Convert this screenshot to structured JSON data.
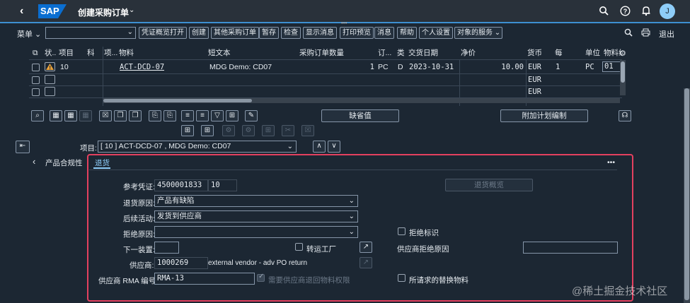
{
  "shell": {
    "logo": "SAP",
    "title": "创建采购订单",
    "avatar_initial": "J",
    "icons": [
      "search-icon",
      "help-icon",
      "bell-icon"
    ]
  },
  "toolbar": {
    "menu_label": "菜单",
    "command_placeholder": "",
    "buttons": [
      "凭证概览打开",
      "创建",
      "其他采购订单",
      "暂存",
      "检查",
      "显示消息",
      "打印预览",
      "消息",
      "帮助",
      "个人设置",
      "对象的服务"
    ],
    "exit_label": "退出"
  },
  "table": {
    "columns": [
      "状...",
      "项目",
      "科",
      "项...",
      "物料",
      "短文本",
      "采购订单数量",
      "订...",
      "类",
      "交货日期",
      "净价",
      "货币",
      "每",
      "单位",
      "物料组"
    ],
    "rows": [
      {
        "item": "10",
        "material": "ACT-DCD-07",
        "short_text": "MDG Demo: CD07",
        "qty": "1",
        "unit": "PC",
        "category": "D",
        "delivery_date": "2023-10-31",
        "net_price": "10.00",
        "currency": "EUR",
        "per": "1",
        "order_unit": "PC",
        "mat_group": "01"
      },
      {
        "item": "",
        "material": "",
        "short_text": "",
        "qty": "",
        "unit": "",
        "category": "",
        "delivery_date": "",
        "net_price": "",
        "currency": "EUR",
        "per": "",
        "order_unit": "",
        "mat_group": ""
      },
      {
        "item": "",
        "material": "",
        "short_text": "",
        "qty": "",
        "unit": "",
        "category": "",
        "delivery_date": "",
        "net_price": "",
        "currency": "EUR",
        "per": "",
        "order_unit": "",
        "mat_group": ""
      }
    ]
  },
  "actions": {
    "default_values": "缺省值",
    "additional_planning": "附加计划编制"
  },
  "item_selector": {
    "label": "项目:",
    "value": "[ 10 ] ACT-DCD-07 , MDG Demo: CD07"
  },
  "tabs": {
    "prev_tab": "产品合规性",
    "active_tab": "退货",
    "more": "•••"
  },
  "returns": {
    "ref_doc_label": "参考凭证:",
    "ref_doc_value": "4500001833",
    "ref_item_value": "10",
    "returns_overview_button": "退货概览",
    "return_reason_label": "退货原因:",
    "return_reason_value": "产品有缺陷",
    "followup_label": "后续活动:",
    "followup_value": "发货到供应商",
    "reject_reason_label": "拒绝原因:",
    "reject_reason_value": "",
    "reject_flag_label": "拒绝标识",
    "next_device_label": "下一装置:",
    "next_device_value": "",
    "transfer_plant_label": "转运工厂",
    "vendor_reject_reason_label": "供应商拒绝原因",
    "vendor_reject_reason_value": "",
    "vendor_label": "供应商:",
    "vendor_value": "1000269",
    "vendor_name": "external vendor - adv PO return",
    "rma_label": "供应商 RMA 编号:",
    "rma_value": "RMA-13",
    "vendor_material_auth_label": "需要供应商退回物料权限",
    "replacement_material_label": "所请求的替换物料"
  },
  "watermark": "@稀土掘金技术社区"
}
